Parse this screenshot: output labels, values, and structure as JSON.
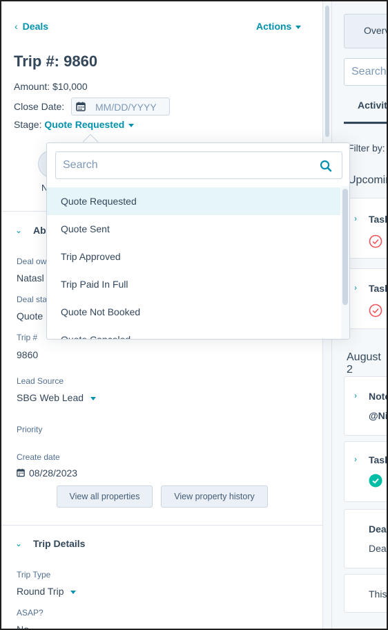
{
  "header": {
    "back_label": "Deals",
    "actions_label": "Actions",
    "title": "Trip #: 9860",
    "amount": "Amount: $10,000",
    "close_date_label": "Close Date:",
    "close_date_placeholder": "MM/DD/YYYY",
    "stage_label": "Stage:",
    "stage_value": "Quote Requested",
    "n_fragment": "N"
  },
  "about": {
    "title_fragment": "Ab",
    "deal_owner_label_fragment": "Deal ow",
    "deal_owner_value_fragment": "Natasl",
    "deal_stage_label_fragment": "Deal sta",
    "deal_stage_value_fragment": "Quote",
    "trip_label": "Trip #",
    "trip_value": "9860",
    "lead_source_label": "Lead Source",
    "lead_source_value": "SBG Web Lead",
    "priority_label": "Priority",
    "create_date_label": "Create date",
    "create_date_value": "08/28/2023",
    "view_all_button": "View all properties",
    "view_history_button": "View property history"
  },
  "trip_details": {
    "title": "Trip Details",
    "trip_type_label": "Trip Type",
    "trip_type_value": "Round Trip",
    "asap_label": "ASAP?",
    "asap_value": "No"
  },
  "dropdown": {
    "search_placeholder": "Search",
    "options": [
      "Quote Requested",
      "Quote Sent",
      "Trip Approved",
      "Trip Paid In Full",
      "Quote Not Booked",
      "Quote Canceled"
    ],
    "selected_index": 0
  },
  "right_panel": {
    "overview_tab_fragment": "Overv",
    "search_placeholder_fragment": "Search",
    "activities_tab_fragment": "Activiti",
    "filter_by_fragment": "Filter by:",
    "upcoming_fragment": "Upcomin",
    "task1_fragment": "Task",
    "task2_fragment": "Task",
    "august_fragment": "August 2",
    "note_fragment": "Note",
    "mention_fragment": "@Ni",
    "task3_fragment": "Task",
    "deal_fragment": "Deal",
    "deal_sub_fragment": "Deal",
    "this_fragment": "This"
  },
  "colors": {
    "accent": "#0091ae",
    "text": "#33475b",
    "border": "#cbd6e2",
    "overdue_red": "#f2545b",
    "complete_green": "#00bda5"
  }
}
